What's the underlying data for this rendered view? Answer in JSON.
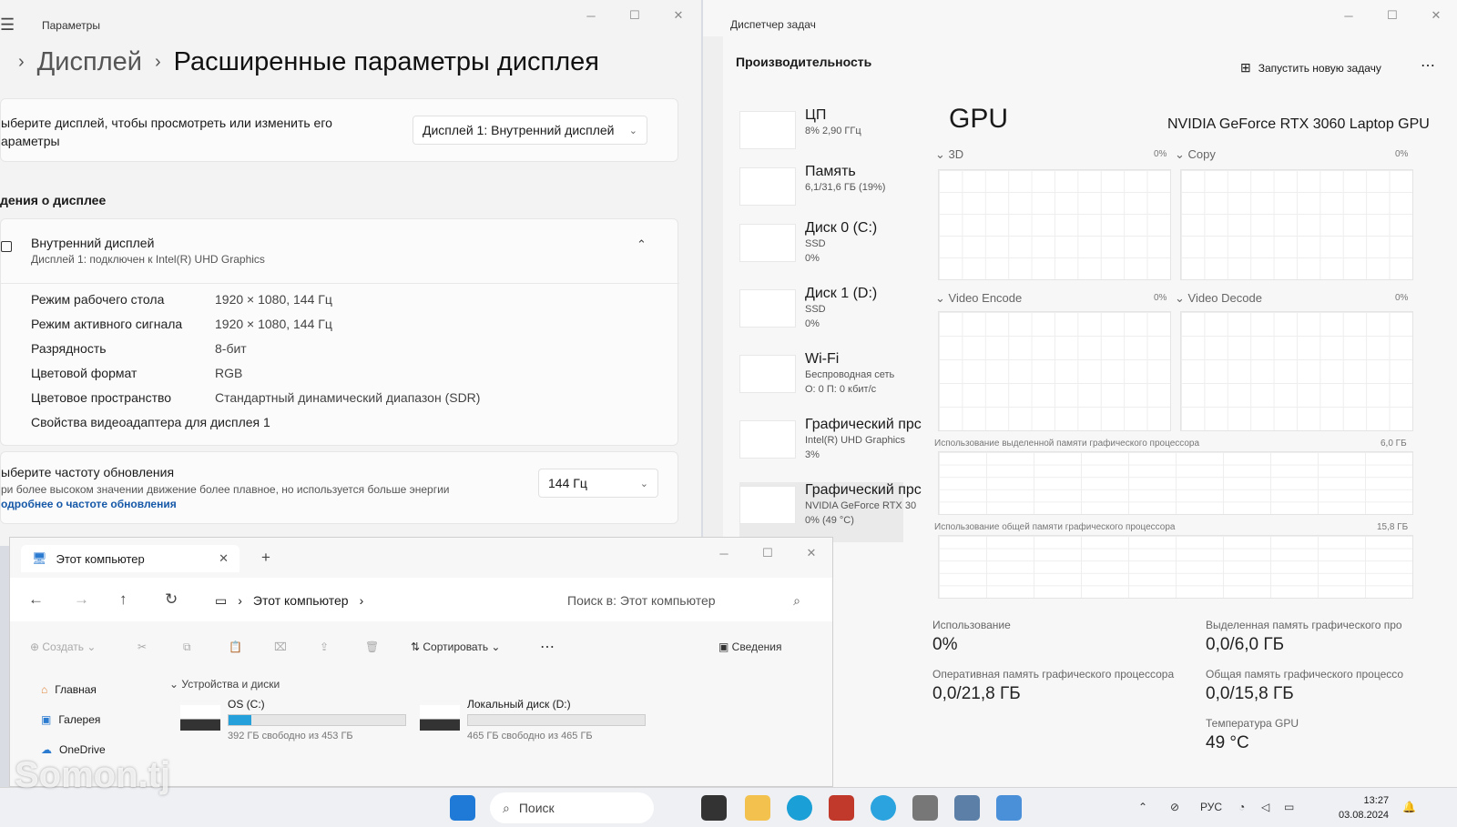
{
  "settings": {
    "window_title": "Параметры",
    "breadcrumb_parent": "Дисплей",
    "breadcrumb_current": "Расширенные параметры дисплея",
    "select_display_text_1": "ыберите дисплей, чтобы просмотреть или изменить его",
    "select_display_text_2": "араметры",
    "display_dropdown_value": "Дисплей 1: Внутренний дисплей",
    "section_title": "дения о дисплее",
    "display_name": "Внутренний дисплей",
    "display_sub": "Дисплей 1: подключен к Intel(R) UHD Graphics",
    "props": [
      {
        "label": "Режим рабочего стола",
        "value": "1920 × 1080, 144 Гц"
      },
      {
        "label": "Режим активного сигнала",
        "value": "1920 × 1080, 144 Гц"
      },
      {
        "label": "Разрядность",
        "value": "8-бит"
      },
      {
        "label": "Цветовой формат",
        "value": "RGB"
      },
      {
        "label": "Цветовое пространство",
        "value": "Стандартный динамический диапазон (SDR)"
      }
    ],
    "adapter_link": "Свойства видеоадаптера для дисплея 1",
    "refresh_title": "ыберите частоту обновления",
    "refresh_desc": "ри более высоком значении движение более плавное, но используется больше энергии",
    "refresh_link": "одробнее о частоте обновления",
    "refresh_value": "144 Гц"
  },
  "taskmgr": {
    "window_title": "Диспетчер задач",
    "heading": "Производительность",
    "run_task": "Запустить новую задачу",
    "resources": [
      {
        "name": "ЦП",
        "s1": "8% 2,90 ГГц",
        "s2": ""
      },
      {
        "name": "Память",
        "s1": "6,1/31,6 ГБ (19%)",
        "s2": ""
      },
      {
        "name": "Диск 0 (C:)",
        "s1": "SSD",
        "s2": "0%"
      },
      {
        "name": "Диск 1 (D:)",
        "s1": "SSD",
        "s2": "0%"
      },
      {
        "name": "Wi-Fi",
        "s1": "Беспроводная сеть",
        "s2": "О: 0 П: 0 кбит/с"
      },
      {
        "name": "Графический прс",
        "s1": "Intel(R) UHD Graphics",
        "s2": "3%"
      },
      {
        "name": "Графический прс",
        "s1": "NVIDIA GeForce RTX 30",
        "s2": "0% (49 °C)"
      }
    ],
    "gpu_title": "GPU",
    "gpu_name": "NVIDIA GeForce RTX 3060 Laptop GPU",
    "engines": [
      {
        "label": "3D",
        "pct": "0%"
      },
      {
        "label": "Copy",
        "pct": "0%"
      },
      {
        "label": "Video Encode",
        "pct": "0%"
      },
      {
        "label": "Video Decode",
        "pct": "0%"
      }
    ],
    "dedicated_label": "Использование выделенной памяти графического процессора",
    "dedicated_max": "6,0 ГБ",
    "shared_label": "Использование общей памяти графического процессора",
    "shared_max": "15,8 ГБ",
    "stats": {
      "util_label": "Использование",
      "util_value": "0%",
      "ded_label": "Выделенная память графического про",
      "ded_value": "0,0/6,0 ГБ",
      "ram_label": "Оперативная память графического процессора",
      "ram_value": "0,0/21,8 ГБ",
      "shared_mem_label": "Общая память графического процессо",
      "shared_mem_value": "0,0/15,8 ГБ",
      "temp_label": "Температура GPU",
      "temp_value": "49 °C"
    }
  },
  "explorer": {
    "tab_title": "Этот компьютер",
    "path": "Этот компьютер",
    "search_placeholder": "Поиск в: Этот компьютер",
    "create": "Создать",
    "sort": "Сортировать",
    "details": "Сведения",
    "sidebar": [
      "Главная",
      "Галерея",
      "OneDrive"
    ],
    "group": "Устройства и диски",
    "drives": [
      {
        "name": "OS (C:)",
        "free": "392 ГБ свободно из 453 ГБ",
        "used_fraction": 0.13
      },
      {
        "name": "Локальный диск (D:)",
        "free": "465 ГБ свободно из 465 ГБ",
        "used_fraction": 0.0
      }
    ]
  },
  "taskbar": {
    "search": "Поиск",
    "lang": "РУС",
    "time": "13:27",
    "date": "03.08.2024"
  },
  "watermark": "Somon.tj"
}
